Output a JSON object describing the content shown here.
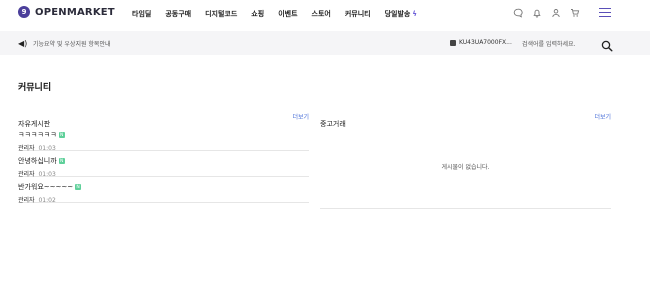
{
  "header": {
    "logo_mark": "9",
    "logo_text": "OPENMARKET",
    "nav": [
      "타임딜",
      "공동구매",
      "디지털코드",
      "쇼핑",
      "이벤트",
      "스토어",
      "커뮤니티",
      "당일발송"
    ],
    "nav_last_icon": "lightning-icon",
    "icons": [
      "chat-icon",
      "bell-icon",
      "user-icon",
      "cart-icon"
    ],
    "menu_icon": "hamburger-icon"
  },
  "subbar": {
    "notice": "기능요약 및 우상지원 항목안내",
    "wallet": "KU43UA7000FX...",
    "search_placeholder": "검색어를 입력하세요."
  },
  "main": {
    "page_title": "커뮤니티",
    "free_board": {
      "title": "자유게시판",
      "more": "더보기",
      "posts": [
        {
          "title": "ㅋㅋㅋㅋㅋㅋ",
          "badge": "N",
          "author": "관리자",
          "time": "01:03"
        },
        {
          "title": "안녕하십니까",
          "badge": "N",
          "author": "관리자",
          "time": "01:03"
        },
        {
          "title": "반가워요~~~~~",
          "badge": "N",
          "author": "관리자",
          "time": "01:02"
        }
      ]
    },
    "used_trade": {
      "title": "중고거래",
      "more": "더보기",
      "empty": "게시물이 없습니다."
    }
  },
  "colors": {
    "brand": "#4b3f9b",
    "accent": "#6a5cd8",
    "link": "#4a6fd8",
    "new_badge": "#5fd09a"
  }
}
